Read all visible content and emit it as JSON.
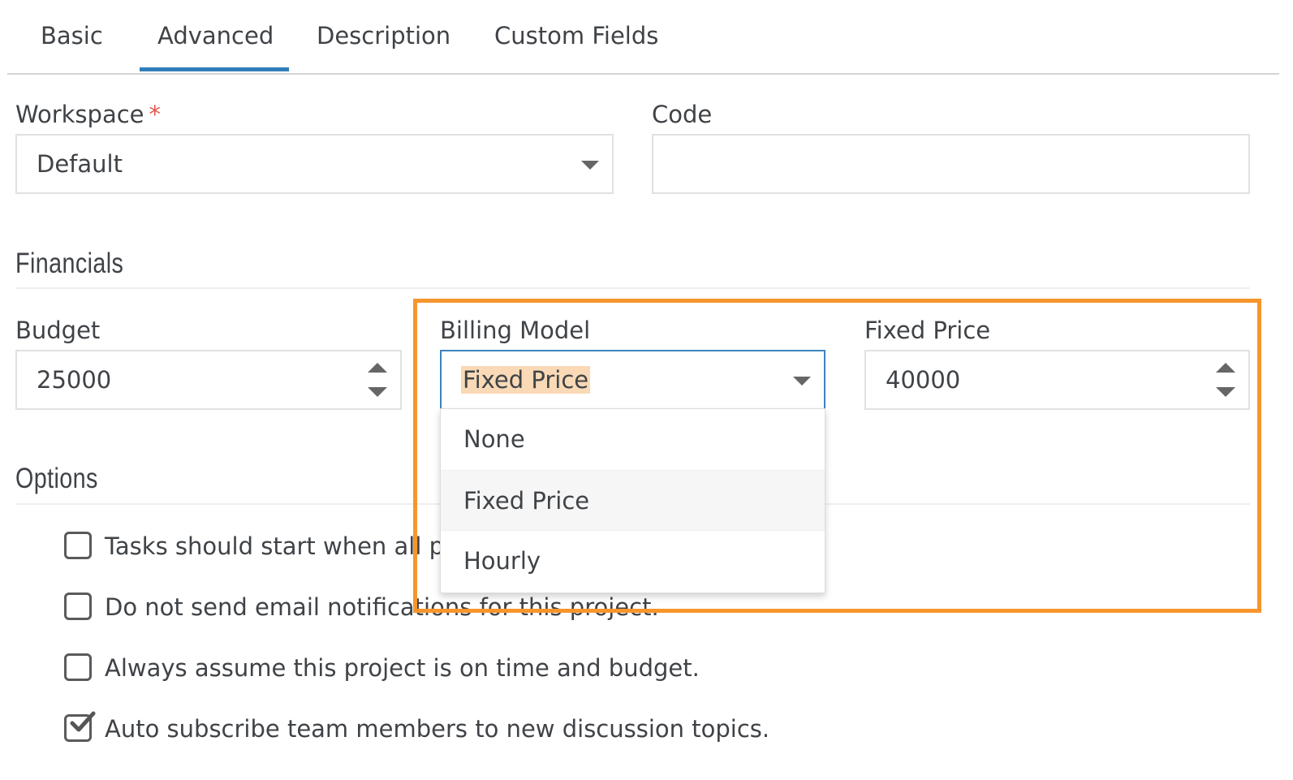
{
  "tabs": [
    {
      "label": "Basic",
      "active": false
    },
    {
      "label": "Advanced",
      "active": true
    },
    {
      "label": "Description",
      "active": false
    },
    {
      "label": "Custom Fields",
      "active": false
    }
  ],
  "workspace": {
    "label": "Workspace",
    "required_mark": "*",
    "value": "Default"
  },
  "code": {
    "label": "Code",
    "value": ""
  },
  "financials": {
    "title": "Financials"
  },
  "budget": {
    "label": "Budget",
    "value": "25000"
  },
  "billing_model": {
    "label": "Billing Model",
    "value": "Fixed Price",
    "options": [
      "None",
      "Fixed Price",
      "Hourly"
    ],
    "selected_index": 1
  },
  "fixed_price": {
    "label": "Fixed Price",
    "value": "40000"
  },
  "options": {
    "title": "Options",
    "items": [
      {
        "label": "Tasks should start when all pr",
        "checked": false
      },
      {
        "label": "Do not send email notifications for this project.",
        "checked": false
      },
      {
        "label": "Always assume this project is on time and budget.",
        "checked": false
      },
      {
        "label": "Auto subscribe team members to new discussion topics.",
        "checked": true
      }
    ]
  },
  "colors": {
    "accent": "#2f7db8",
    "annotation": "#f7962c",
    "required": "#e2574c",
    "highlight": "#f9d9b6"
  }
}
